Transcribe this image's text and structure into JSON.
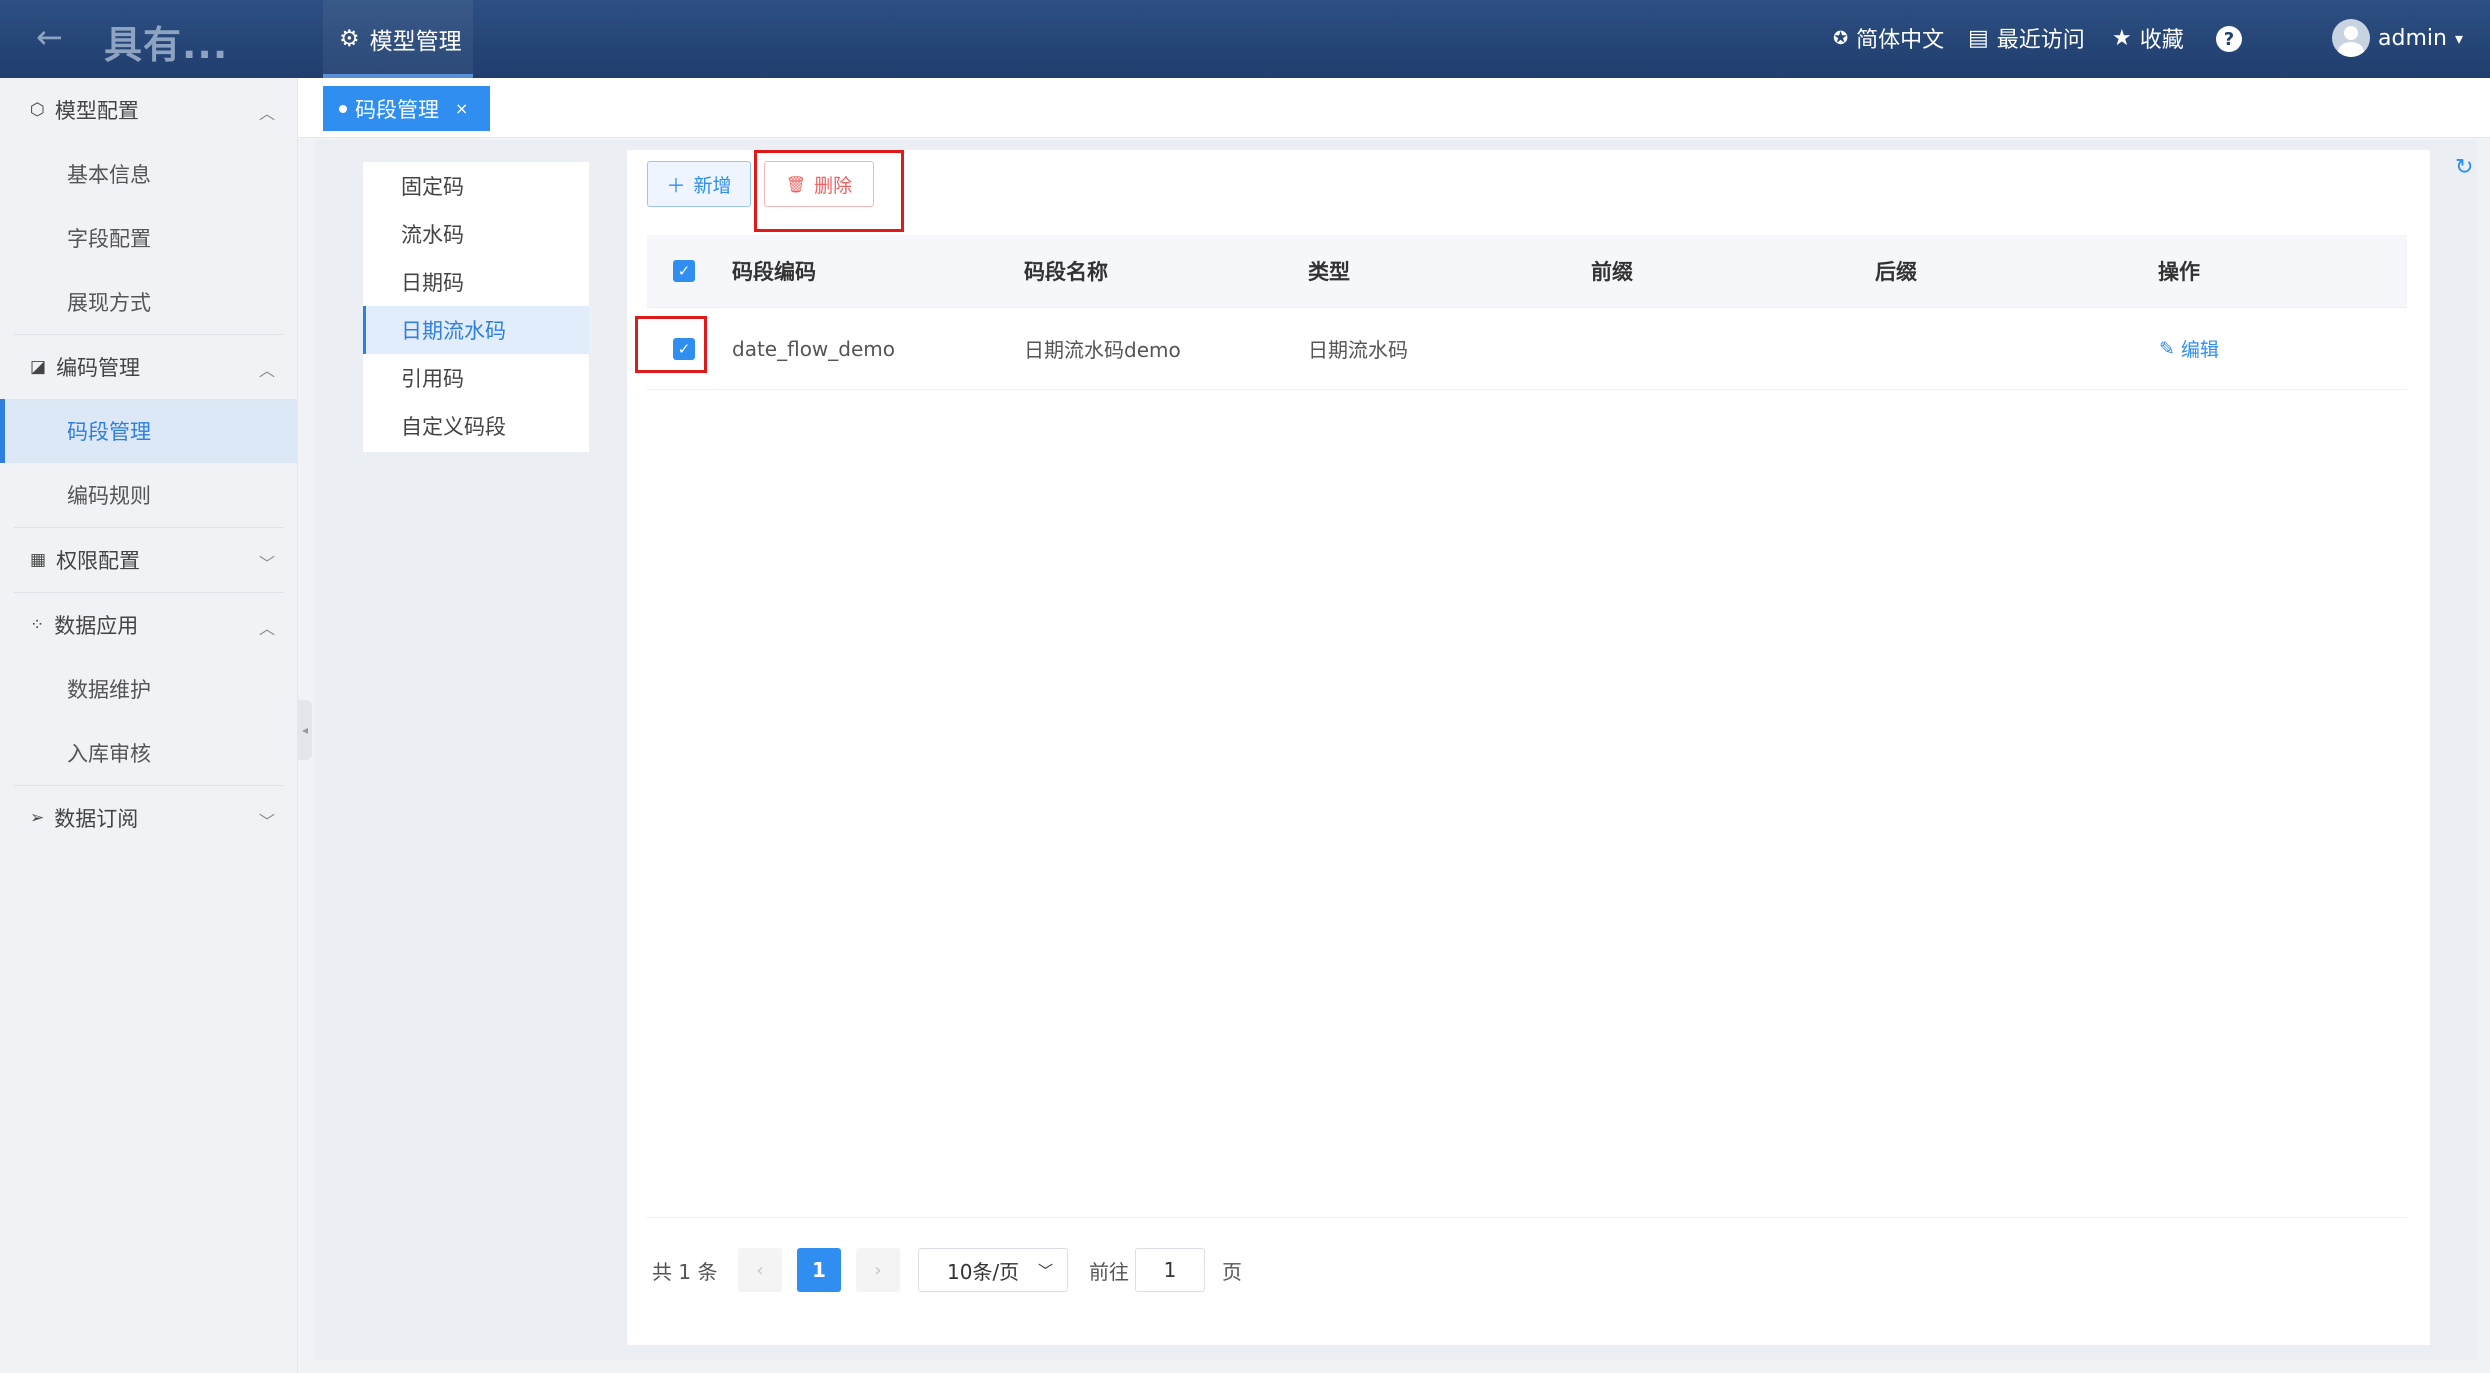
{
  "header": {
    "brand": "具有...",
    "module": "模型管理",
    "language": "简体中文",
    "recent": "最近访问",
    "favorite": "收藏",
    "help": "?",
    "user": "admin"
  },
  "sidebar": {
    "groups": [
      {
        "label": "模型配置",
        "items": [
          "基本信息",
          "字段配置",
          "展现方式"
        ]
      },
      {
        "label": "编码管理",
        "items": [
          "码段管理",
          "编码规则"
        ]
      },
      {
        "label": "权限配置",
        "items": []
      },
      {
        "label": "数据应用",
        "items": [
          "数据维护",
          "入库审核"
        ]
      },
      {
        "label": "数据订阅",
        "items": []
      }
    ]
  },
  "tabs": {
    "active": "码段管理",
    "close": "×"
  },
  "segment_types": [
    "固定码",
    "流水码",
    "日期码",
    "日期流水码",
    "引用码",
    "自定义码段"
  ],
  "toolbar": {
    "add_label": "新增",
    "delete_label": "删除"
  },
  "table": {
    "columns": [
      "码段编码",
      "码段名称",
      "类型",
      "前缀",
      "后缀",
      "操作"
    ],
    "rows": [
      {
        "code": "date_flow_demo",
        "name": "日期流水码demo",
        "type": "日期流水码",
        "prefix": "",
        "suffix": "",
        "action": "编辑"
      }
    ]
  },
  "pagination": {
    "total_text": "共 1 条",
    "current_page": "1",
    "page_size": "10条/页",
    "goto_prefix": "前往",
    "goto_value": "1",
    "goto_suffix": "页"
  }
}
